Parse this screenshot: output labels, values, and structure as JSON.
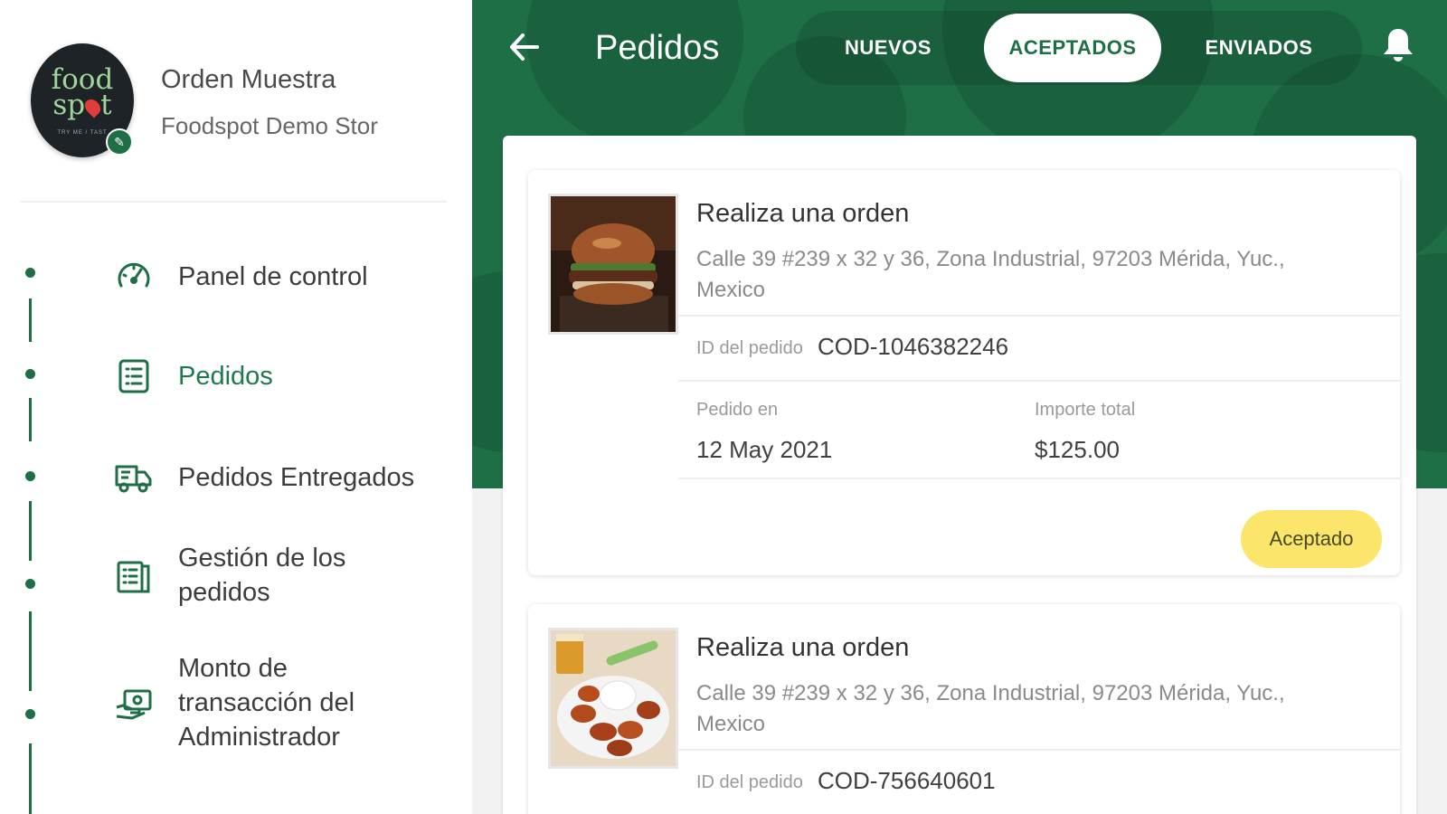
{
  "sidebar": {
    "logo": {
      "line1": "food",
      "line2_a": "sp",
      "line2_b": "t",
      "tagline": "TRY ME / TAST"
    },
    "edit_icon": "pencil-icon",
    "store_title": "Orden Muestra",
    "store_subtitle": "Foodspot Demo Stor",
    "nav": [
      {
        "label": "Panel de control",
        "icon": "speedometer-icon",
        "active": false
      },
      {
        "label": "Pedidos",
        "icon": "list-icon",
        "active": true
      },
      {
        "label": "Pedidos Entregados",
        "icon": "delivery-truck-icon",
        "active": false
      },
      {
        "label_lines": [
          "Gestión de los",
          "pedidos"
        ],
        "icon": "order-management-icon",
        "active": false
      },
      {
        "label_lines": [
          "Monto de",
          "transacción del",
          "Administrador"
        ],
        "icon": "money-transfer-icon",
        "active": false
      }
    ]
  },
  "header": {
    "title": "Pedidos",
    "back_icon": "arrow-left-icon",
    "bell_icon": "bell-icon",
    "tabs": [
      {
        "label": "NUEVOS",
        "active": false
      },
      {
        "label": "ACEPTADOS",
        "active": true
      },
      {
        "label": "ENVIADOS",
        "active": false
      }
    ]
  },
  "orders": [
    {
      "title": "Realiza una orden",
      "address": "Calle 39 #239 x 32 y 36, Zona Industrial, 97203 Mérida, Yuc., Mexico",
      "id_label": "ID del pedido",
      "id_value": "COD-1046382246",
      "date_label": "Pedido en",
      "date_value": "12 May 2021",
      "total_label": "Importe total",
      "total_value": "$125.00",
      "status": "Aceptado",
      "image": "burger-photo"
    },
    {
      "title": "Realiza una orden",
      "address": "Calle 39 #239 x 32 y 36, Zona Industrial, 97203 Mérida, Yuc., Mexico",
      "id_label": "ID del pedido",
      "id_value": "COD-756640601",
      "image": "chicken-wings-photo"
    }
  ],
  "colors": {
    "brand_green": "#1e6e46",
    "status_yellow": "#fbe56a",
    "panel_bg": "#f2f2f2"
  }
}
